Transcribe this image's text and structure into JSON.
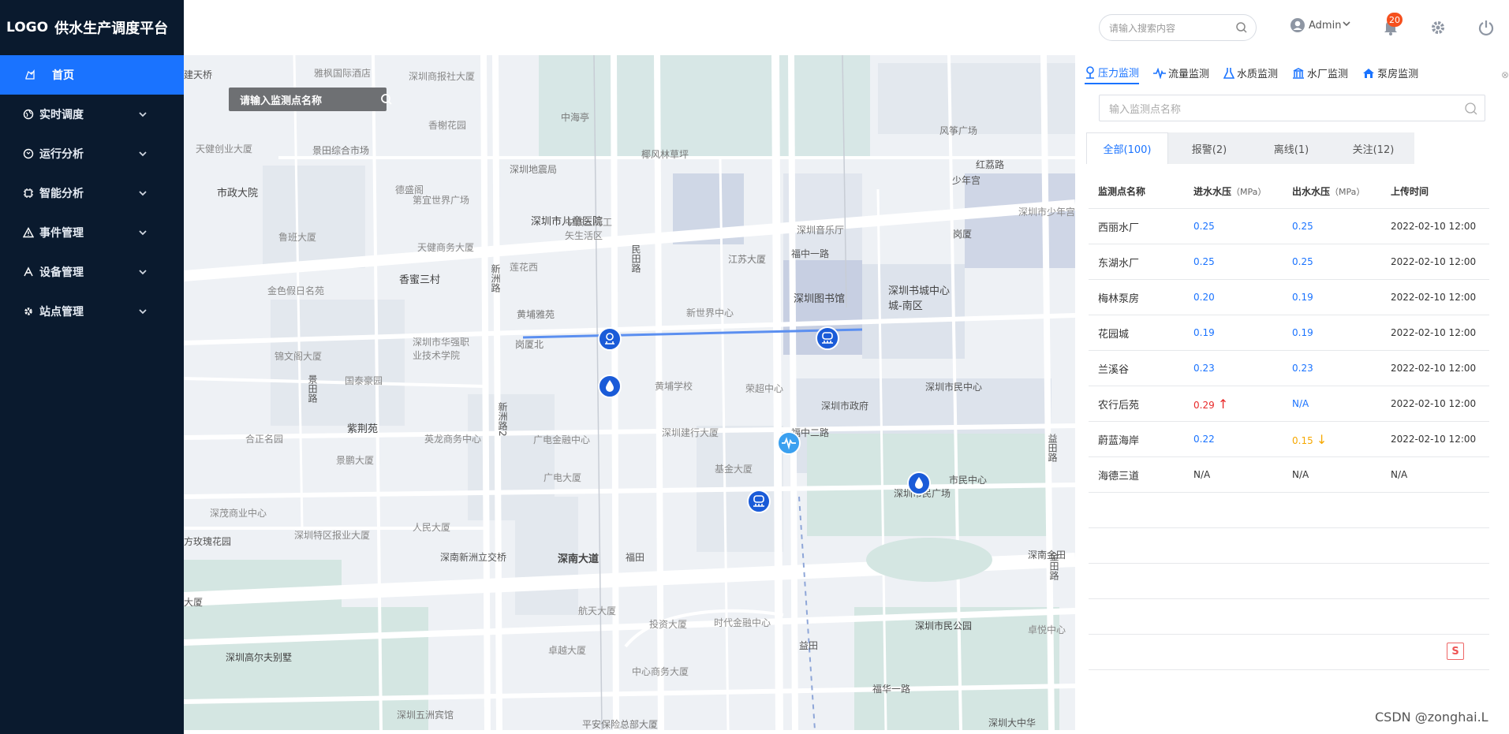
{
  "app": {
    "logo": "LOGO",
    "title": "供水生产调度平台"
  },
  "sidebar": {
    "items": [
      {
        "label": "首页",
        "icon": "home-map-icon",
        "active": true
      },
      {
        "label": "实时调度",
        "icon": "globe-icon"
      },
      {
        "label": "运行分析",
        "icon": "analysis-icon"
      },
      {
        "label": "智能分析",
        "icon": "chip-icon"
      },
      {
        "label": "事件管理",
        "icon": "warning-icon"
      },
      {
        "label": "设备管理",
        "icon": "device-icon"
      },
      {
        "label": "站点管理",
        "icon": "gear-icon"
      }
    ]
  },
  "header": {
    "search_placeholder": "请输入搜索内容",
    "user": "Admin",
    "notification_count": "20"
  },
  "map": {
    "search_placeholder": "请输入监测点名称",
    "labels": [
      "深圳市儿童医院",
      "深圳图书馆",
      "深圳书城中心城-南区",
      "深圳市民中心",
      "深圳市政府",
      "深圳市民广场",
      "深圳市民公园",
      "香蜜三村",
      "市政大院",
      "紫荆苑",
      "深南大道",
      "福中一路",
      "福中二路",
      "福华一路",
      "红荔路",
      "民田路",
      "新洲路",
      "益田路",
      "深圳高尔夫别墅",
      "深南新洲立交桥",
      "景田综合市场",
      "深圳地震局",
      "岗厦北",
      "黄埔雅苑",
      "深圳音乐厅",
      "江苏大厦",
      "少年宫",
      "新世界中心",
      "黄埔学校",
      "荣超中心",
      "深圳建行大厦",
      "广电金融中心",
      "广电大厦",
      "基金大厦",
      "福田",
      "深圳特区报业大厦",
      "人民大厦",
      "航天大厦",
      "投资大厦",
      "时代金融中心",
      "卓越大厦",
      "中心商务大厦",
      "深圳五洲宾馆",
      "平安保险总部大厦",
      "深圳大中华",
      "岗厦",
      "深圳市少年宫",
      "市民中心",
      "金田路",
      "深南金田",
      "卓悦中心",
      "中海亭",
      "椰风林草坪",
      "风筝广场",
      "天健创业大厦",
      "金色假日名苑",
      "鲁班大厦",
      "深圳市华强职业技术学院",
      "国泰豪园",
      "英龙商务中心",
      "景鹏大厦",
      "合正名园",
      "深茂商业中心",
      "方玫瑰花园",
      "大厦",
      "益田",
      "建天桥",
      "雅枫国际酒店",
      "深圳商报社大厦",
      "香榭花园",
      "德盛阁",
      "第宜世界广场",
      "天健商务大厦",
      "莲花西",
      "中铁三局工矢生活区",
      "锦文阁大厦",
      "景田路",
      "新洲路2"
    ]
  },
  "panel": {
    "tabs": [
      {
        "label": "压力监测",
        "icon": "pressure-icon",
        "active": true
      },
      {
        "label": "流量监测",
        "icon": "flow-icon"
      },
      {
        "label": "水质监测",
        "icon": "flask-icon"
      },
      {
        "label": "水厂监测",
        "icon": "plant-icon"
      },
      {
        "label": "泵房监测",
        "icon": "pump-house-icon"
      }
    ],
    "search_placeholder": "输入监测点名称",
    "filters": [
      {
        "label": "全部(100)",
        "active": true
      },
      {
        "label": "报警(2)"
      },
      {
        "label": "离线(1)"
      },
      {
        "label": "关注(12)"
      }
    ],
    "table": {
      "headers": [
        "监测点名称",
        "进水水压",
        "出水水压",
        "上传时间"
      ],
      "unit": "（MPa）",
      "rows": [
        {
          "name": "西丽水厂",
          "in": "0.25",
          "out": "0.25",
          "time": "2022-02-10 12:00",
          "in_state": "normal",
          "out_state": "normal"
        },
        {
          "name": "东湖水厂",
          "in": "0.25",
          "out": "0.25",
          "time": "2022-02-10 12:00",
          "in_state": "normal",
          "out_state": "normal"
        },
        {
          "name": "梅林泵房",
          "in": "0.20",
          "out": "0.19",
          "time": "2022-02-10 12:00",
          "in_state": "normal",
          "out_state": "normal"
        },
        {
          "name": "花园城",
          "in": "0.19",
          "out": "0.19",
          "time": "2022-02-10 12:00",
          "in_state": "normal",
          "out_state": "normal"
        },
        {
          "name": "兰溪谷",
          "in": "0.23",
          "out": "0.23",
          "time": "2022-02-10 12:00",
          "in_state": "normal",
          "out_state": "normal"
        },
        {
          "name": "农行后苑",
          "in": "0.29",
          "out": "N/A",
          "time": "2022-02-10 12:00",
          "in_state": "high",
          "out_state": "normal"
        },
        {
          "name": "蔚蓝海岸",
          "in": "0.22",
          "out": "0.15",
          "time": "2022-02-10 12:00",
          "in_state": "normal",
          "out_state": "low"
        },
        {
          "name": "海德三道",
          "in": "N/A",
          "out": "N/A",
          "time": "N/A",
          "in_state": "na",
          "out_state": "na"
        }
      ]
    }
  },
  "watermark": "CSDN @zonghai.L",
  "colors": {
    "accent": "#1a73ff",
    "sidebar": "#0a1a2e",
    "alarm_high": "#e82a2a",
    "alarm_low": "#f6a800"
  }
}
